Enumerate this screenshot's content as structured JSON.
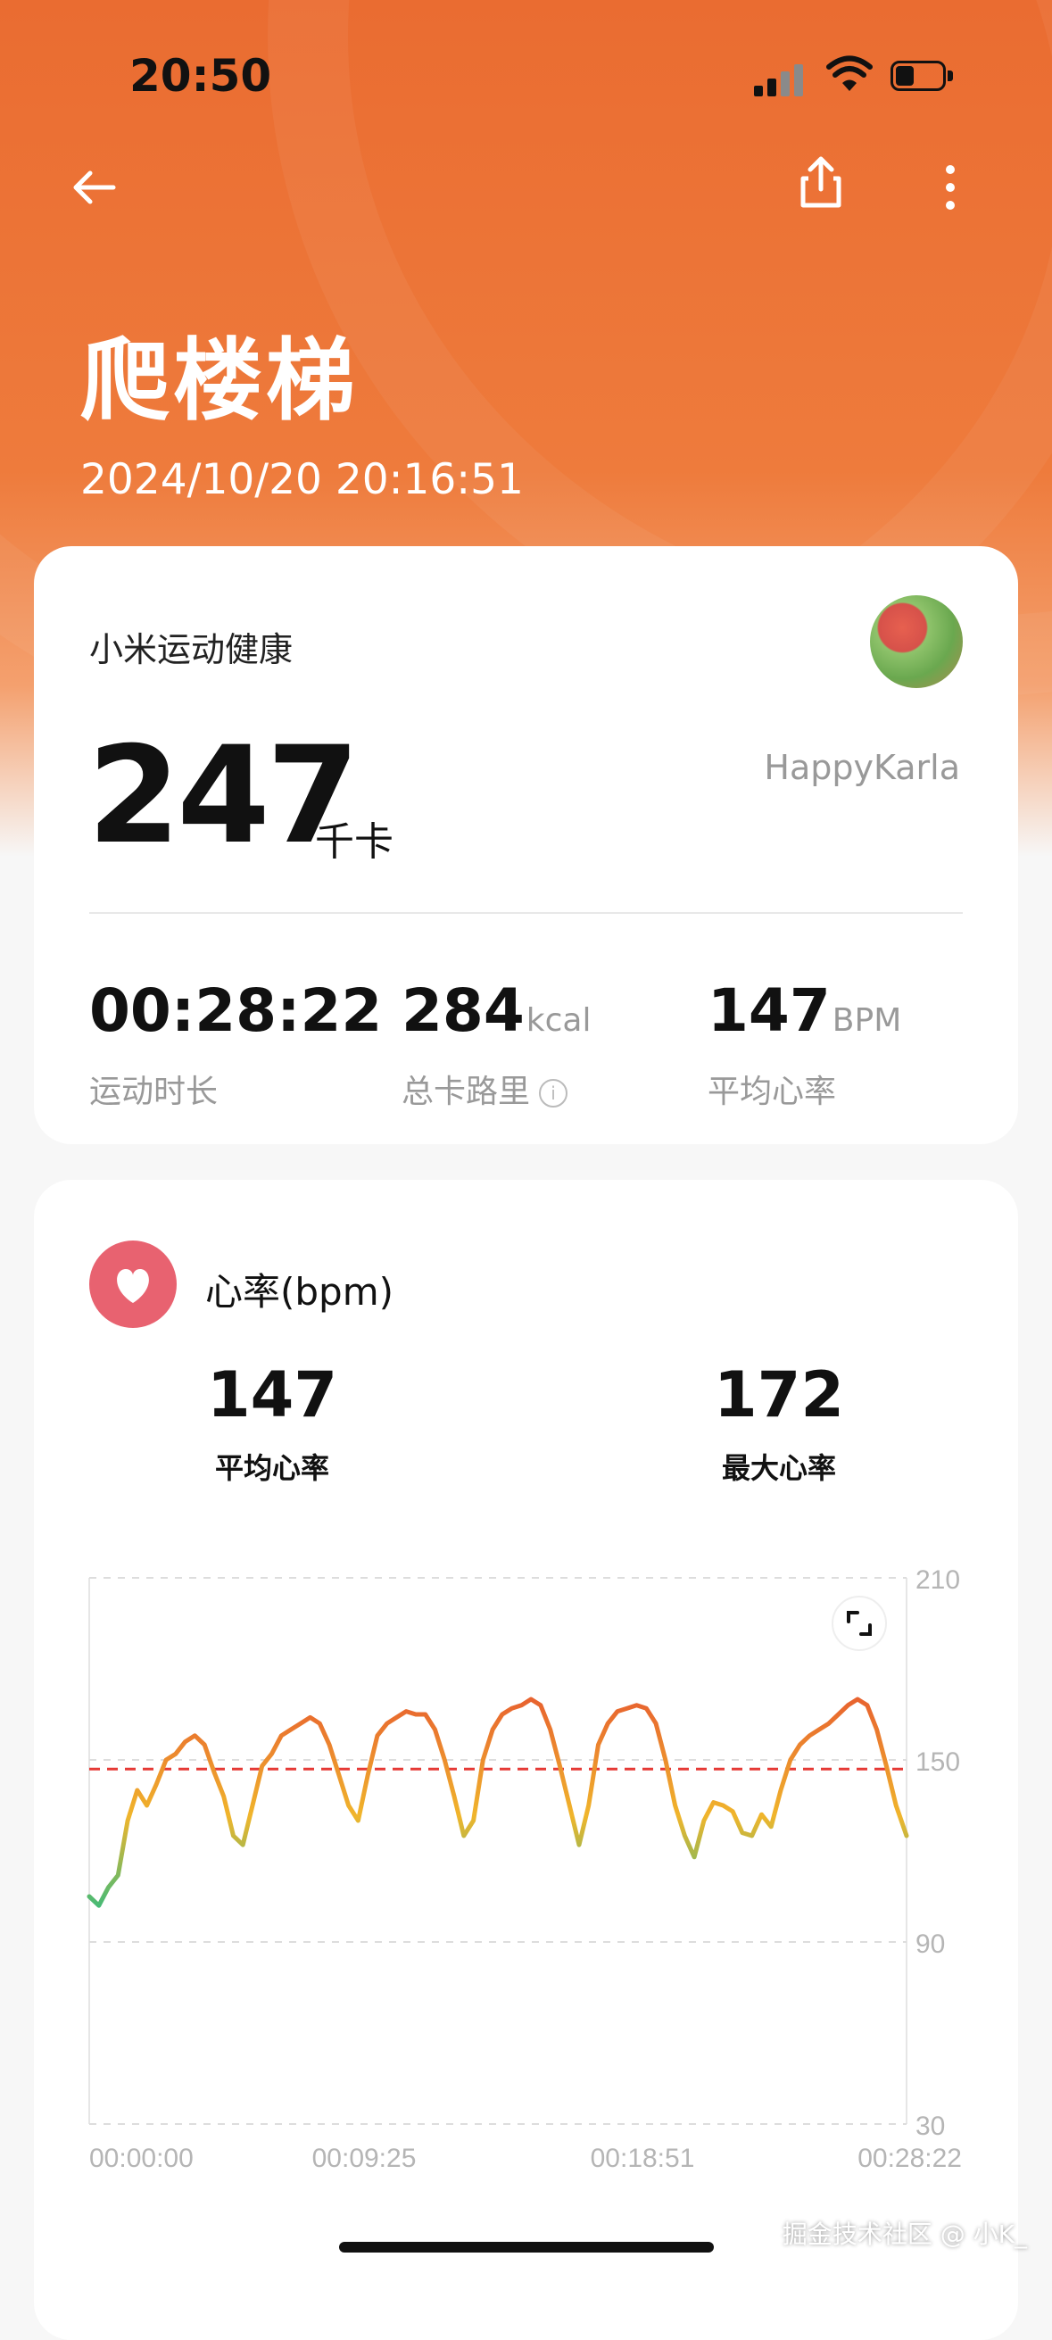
{
  "status_bar": {
    "time": "20:50"
  },
  "header": {
    "title": "爬楼梯",
    "datetime": "2024/10/20 20:16:51"
  },
  "summary": {
    "app_name": "小米运动健康",
    "username": "HappyKarla",
    "calories": "247",
    "calories_unit": "千卡",
    "stats": [
      {
        "value": "00:28:22",
        "unit": "",
        "label": "运动时长"
      },
      {
        "value": "284",
        "unit": "kcal",
        "label": "总卡路里"
      },
      {
        "value": "147",
        "unit": "BPM",
        "label": "平均心率"
      }
    ]
  },
  "heart_rate": {
    "title": "心率(bpm)",
    "avg_value": "147",
    "avg_label": "平均心率",
    "max_value": "172",
    "max_label": "最大心率"
  },
  "chart_data": {
    "type": "line",
    "y_ticks": [
      "210",
      "150",
      "90",
      "30"
    ],
    "x_ticks": [
      "00:00:00",
      "00:09:25",
      "00:18:51",
      "00:28:22"
    ],
    "ylim": [
      30,
      210
    ],
    "xlim": [
      0,
      1702
    ],
    "reference_line": 147,
    "series": [
      {
        "x": [
          0,
          20,
          40,
          60,
          80,
          100,
          120,
          140,
          160,
          180,
          200,
          220,
          240,
          260,
          280,
          300,
          320,
          340,
          360,
          380,
          400,
          420,
          440,
          460,
          480,
          500,
          520,
          540,
          560,
          580,
          600,
          620,
          640,
          660,
          680,
          700,
          720,
          740,
          760,
          780,
          800,
          820,
          840,
          860,
          880,
          900,
          920,
          940,
          960,
          980,
          1000,
          1020,
          1040,
          1060,
          1080,
          1100,
          1120,
          1140,
          1160,
          1180,
          1200,
          1220,
          1240,
          1260,
          1280,
          1300,
          1320,
          1340,
          1360,
          1380,
          1400,
          1420,
          1440,
          1460,
          1480,
          1500,
          1520,
          1540,
          1560,
          1580,
          1600,
          1620,
          1640,
          1660,
          1680,
          1702
        ],
        "y": [
          105,
          102,
          108,
          112,
          130,
          140,
          135,
          142,
          150,
          152,
          156,
          158,
          155,
          146,
          138,
          125,
          122,
          135,
          148,
          152,
          158,
          160,
          162,
          164,
          162,
          155,
          145,
          135,
          130,
          145,
          158,
          162,
          164,
          166,
          165,
          165,
          160,
          150,
          138,
          125,
          130,
          150,
          160,
          165,
          167,
          168,
          170,
          168,
          160,
          148,
          135,
          122,
          135,
          155,
          162,
          166,
          167,
          168,
          167,
          162,
          150,
          135,
          125,
          118,
          130,
          136,
          135,
          133,
          126,
          125,
          132,
          128,
          140,
          150,
          155,
          158,
          160,
          162,
          165,
          168,
          170,
          168,
          160,
          148,
          135,
          125
        ]
      }
    ],
    "colors": {
      "high": "#e8632f",
      "mid": "#f0b52c",
      "low": "#3dbb7a",
      "reference": "#e53935"
    }
  },
  "watermark": "掘金技术社区 @ 小K_"
}
